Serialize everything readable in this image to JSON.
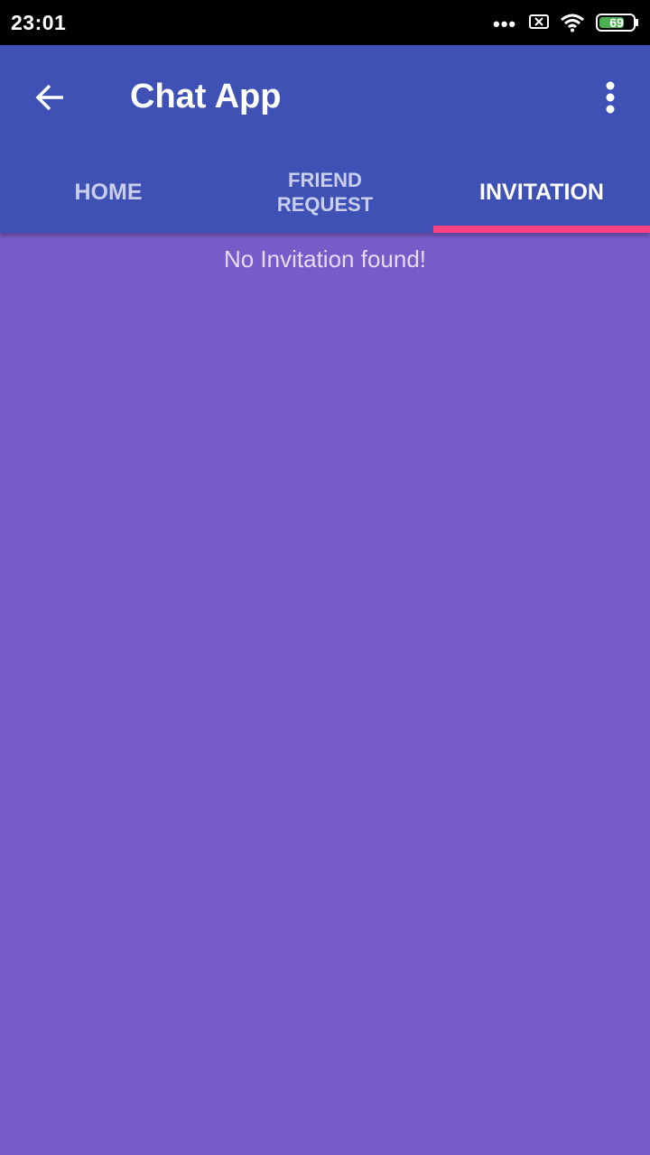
{
  "status_bar": {
    "time": "23:01",
    "dots": "•••",
    "battery_level": "69",
    "icons": [
      "sim-off-icon",
      "wifi-icon",
      "battery-icon"
    ]
  },
  "app_bar": {
    "title": "Chat App",
    "back_icon": "arrow-back-icon",
    "menu_icon": "more-vert-icon"
  },
  "tabs": [
    {
      "label": "HOME",
      "active": false
    },
    {
      "label_line1": "FRIEND",
      "label_line2": "REQUEST",
      "active": false
    },
    {
      "label": "INVITATION",
      "active": true
    }
  ],
  "content": {
    "empty_message": "No Invitation found!"
  },
  "colors": {
    "status_bar": "#000000",
    "app_bar": "#3f51b5",
    "tab_indicator": "#ff4081",
    "background": "#775bc8",
    "battery_fill": "#4caf50"
  }
}
